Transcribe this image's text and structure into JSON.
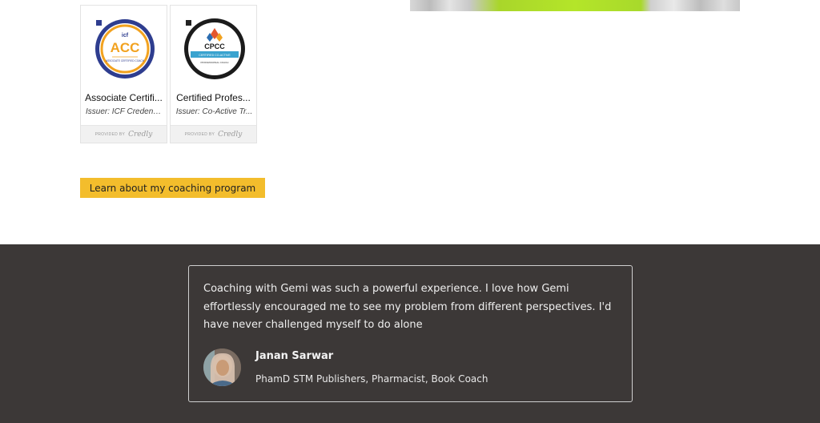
{
  "badges": [
    {
      "title": "Associate Certifi...",
      "issuer": "Issuer: ICF Credenti...",
      "emblem_text": "ACC",
      "emblem_logo": "icf",
      "emblem_sub": "ASSOCIATE CERTIFIED COACH",
      "provider_prefix": "PROVIDED BY",
      "provider_name": "Credly"
    },
    {
      "title": "Certified Profes...",
      "issuer": "Issuer: Co-Active Tr...",
      "emblem_text": "CPCC",
      "emblem_sub": "CERTIFIED CO-ACTIVE",
      "emblem_sub2": "PROFESSIONAL COACH",
      "provider_prefix": "PROVIDED BY",
      "provider_name": "Credly"
    }
  ],
  "cta": {
    "label": "Learn about my coaching program"
  },
  "testimonial": {
    "quote_lines": [
      "Coaching with Gemi was such a powerful experience. I love how Gemi",
      "effortlessly encouraged me to see my problem from different perspectives. I'd",
      "have never challenged myself to do alone"
    ],
    "name": "Janan Sarwar",
    "role": "PhamD STM Publishers, Pharmacist, Book Coach"
  },
  "colors": {
    "accent": "#f3bd2c",
    "band_bg": "#3c3837",
    "acc_ring": "#f2a21f",
    "acc_navy": "#2e3d8f",
    "cpcc_blue": "#3aa3cf"
  }
}
